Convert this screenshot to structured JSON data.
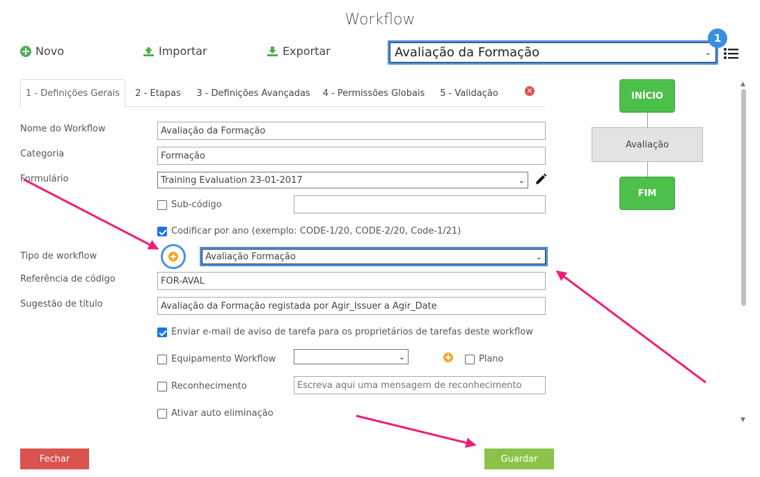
{
  "title": "Workflow",
  "toolbar": {
    "new_label": "Novo",
    "import_label": "Importar",
    "export_label": "Exportar"
  },
  "workflow_select": {
    "value": "Avaliação da Formação",
    "badge": "1"
  },
  "tabs": [
    {
      "label": "1 - Definições Gerais"
    },
    {
      "label": "2 - Etapas"
    },
    {
      "label": "3 - Definições Avançadas"
    },
    {
      "label": "4 - Permissões Globais"
    },
    {
      "label": "5 - Validação"
    }
  ],
  "form": {
    "nome": {
      "label": "Nome do Workflow",
      "value": "Avaliação da Formação"
    },
    "categoria": {
      "label": "Categoria",
      "value": "Formação"
    },
    "formulario": {
      "label": "Formulário",
      "value": "Training Evaluation 23-01-2017"
    },
    "subcodigo": {
      "label": "Sub-código",
      "value": ""
    },
    "codificar": {
      "label": "Codificar por ano (exemplo: CODE-1/20, CODE-2/20, Code-1/21)"
    },
    "tipo": {
      "label": "Tipo de workflow",
      "value": "Avaliação Formação"
    },
    "referencia": {
      "label": "Referência de código",
      "value": "FOR-AVAL"
    },
    "sugestao": {
      "label": "Sugestão de título",
      "value": "Avaliação da Formação registada por Agir_Issuer a Agir_Date"
    },
    "enviar": {
      "label": "Enviar e-mail de aviso de tarefa para os proprietários de tarefas deste workflow"
    },
    "equipamento": {
      "label": "Equipamento Workflow",
      "value": ""
    },
    "plano": {
      "label": "Plano"
    },
    "reconhecimento": {
      "label": "Reconhecimento",
      "placeholder": "Escreva aqui uma mensagem de reconhecimento"
    },
    "auto": {
      "label": "Ativar auto eliminação"
    }
  },
  "buttons": {
    "close_label": "Fechar",
    "save_label": "Guardar"
  },
  "diagram": {
    "start": "INÍCIO",
    "middle": "Avaliação",
    "end": "FIM"
  },
  "colors": {
    "accent": "#4a90e2",
    "green": "#4cc04a",
    "red": "#d9534f",
    "save": "#8bc34a",
    "annotation": "#ee1f78"
  }
}
